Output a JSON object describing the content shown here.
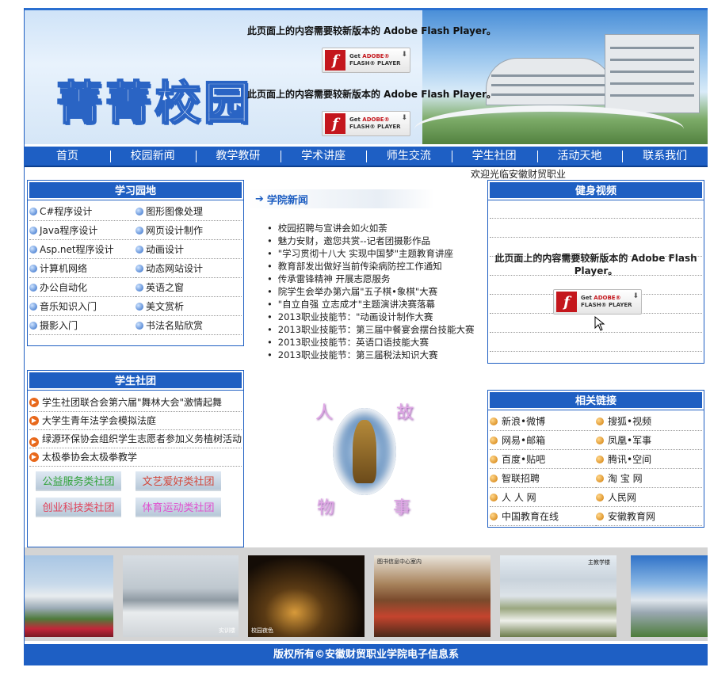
{
  "banner": {
    "title": "菁菁校园",
    "flash_message": "此页面上的内容需要较新版本的 Adobe Flash Player。",
    "flash_button": {
      "get": "Get",
      "adobe": "ADOBE®",
      "product": "FLASH® PLAYER",
      "logo": "f"
    }
  },
  "nav": {
    "items": [
      "首页",
      "校园新闻",
      "教学教研",
      "学术讲座",
      "师生交流",
      "学生社团",
      "活动天地",
      "联系我们"
    ]
  },
  "welcome": "欢迎光临安徽财贸职业",
  "study": {
    "title": "学习园地",
    "items": [
      "C#程序设计",
      "图形图像处理",
      "Java程序设计",
      "网页设计制作",
      "Asp.net程序设计",
      "动画设计",
      "计算机网络",
      "动态网站设计",
      "办公自动化",
      "英语之窗",
      "音乐知识入门",
      "美文赏析",
      "摄影入门",
      "书法名贴欣赏"
    ]
  },
  "clubs": {
    "title": "学生社团",
    "items": [
      "学生社团联合会第六届\"舞林大会\"激情起舞",
      "大学生青年法学会模拟法庭",
      "绿源环保协会组织学生志愿者参加义务植树活动",
      "太极拳协会太极拳教学"
    ],
    "tags": [
      "公益服务类社团",
      "文艺爱好类社团",
      "创业科技类社团",
      "体育运动类社团"
    ]
  },
  "news": {
    "title": "学院新闻",
    "items": [
      "校园招聘与宣讲会如火如荼",
      "魅力安财，邀您共赏--记者团摄影作品",
      "\"学习贯彻十八大 实现中国梦\"主题教育讲座",
      "教育部发出做好当前传染病防控工作通知",
      "传承雷锋精神    开展志愿服务",
      "院学生会举办第六届\"五子棋•象棋\"大赛",
      "\"自立自强 立志成才\"主题演讲决赛落幕",
      "2013职业技能节：\"动画设计制作大赛",
      "2013职业技能节：第三届中餐宴会摆台技能大赛",
      "2013职业技能节：英语口语技能大赛",
      "2013职业技能节：第三届税法知识大赛"
    ]
  },
  "emblem": {
    "chars": [
      "人",
      "故",
      "物",
      "事"
    ]
  },
  "video": {
    "title": "健身视频",
    "flash_message": "此页面上的内容需要较新版本的 Adobe Flash Player。"
  },
  "links": {
    "title": "相关链接",
    "items": [
      "新浪•微博",
      "搜狐•视频",
      "网易•邮箱",
      "凤凰•军事",
      "百度•贴吧",
      "腾讯•空间",
      "智联招聘",
      "淘 宝 网",
      "人 人 网",
      "人民网",
      "中国教育在线",
      "安徽教育网"
    ]
  },
  "photos": {
    "captions": [
      "实训楼",
      "校园夜色",
      "图书信息中心室内",
      "主教学楼"
    ]
  },
  "footer": "版权所有©安徽财贸职业学院电子信息系"
}
